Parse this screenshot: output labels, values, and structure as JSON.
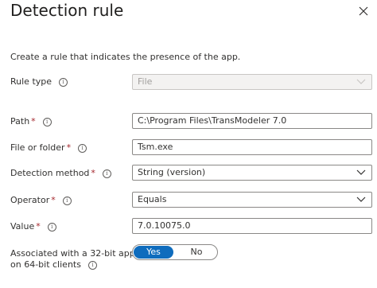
{
  "panel": {
    "title": "Detection rule",
    "description": "Create a rule that indicates the presence of the app."
  },
  "fields": {
    "rule_type": {
      "label": "Rule type",
      "value": "File",
      "disabled": true
    },
    "path": {
      "label": "Path",
      "value": "C:\\Program Files\\TransModeler 7.0",
      "required": true
    },
    "file_or_folder": {
      "label": "File or folder",
      "value": "Tsm.exe",
      "required": true
    },
    "detection_method": {
      "label": "Detection method",
      "value": "String (version)",
      "required": true
    },
    "operator": {
      "label": "Operator",
      "value": "Equals",
      "required": true
    },
    "value": {
      "label": "Value",
      "value": "7.0.10075.0",
      "required": true
    },
    "associated_32bit": {
      "label_line1": "Associated with a 32-bit app",
      "label_line2": "on 64-bit clients",
      "options": [
        "Yes",
        "No"
      ],
      "selected": "Yes"
    }
  },
  "symbols": {
    "required": "*",
    "info": "i"
  },
  "icons": {
    "close": "close-icon",
    "info": "info-icon",
    "dropdown": "chevron-down-icon"
  },
  "colors": {
    "accent": "#0f6cbd",
    "required": "#a4262c"
  }
}
